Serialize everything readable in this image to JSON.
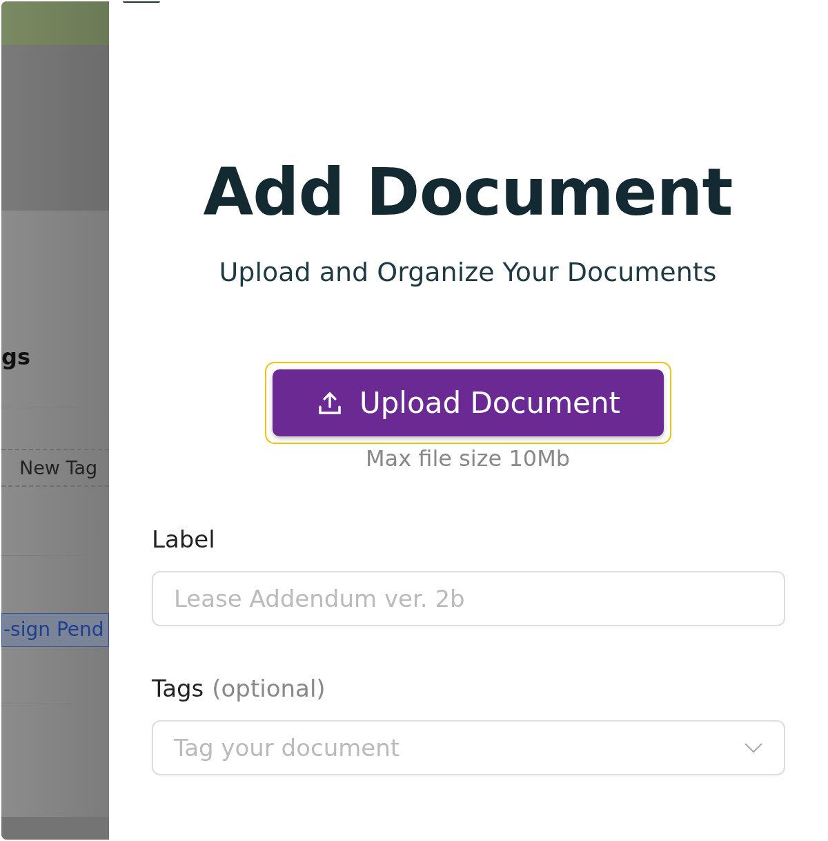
{
  "background": {
    "heading": "gs",
    "new_tag": "New Tag",
    "tag": "-sign Pend"
  },
  "dialog": {
    "title": "Add Document",
    "subtitle": "Upload and Organize Your Documents",
    "upload_button": {
      "label": "Upload Document",
      "focused": true
    },
    "upload_hint": "Max file size 10Mb",
    "fields": [
      {
        "kind": "text",
        "label": "Label",
        "placeholder": "Lease Addendum ver. 2b"
      },
      {
        "kind": "select",
        "label": "Tags",
        "label_note": "(optional)",
        "placeholder": "Tag your document"
      }
    ]
  }
}
